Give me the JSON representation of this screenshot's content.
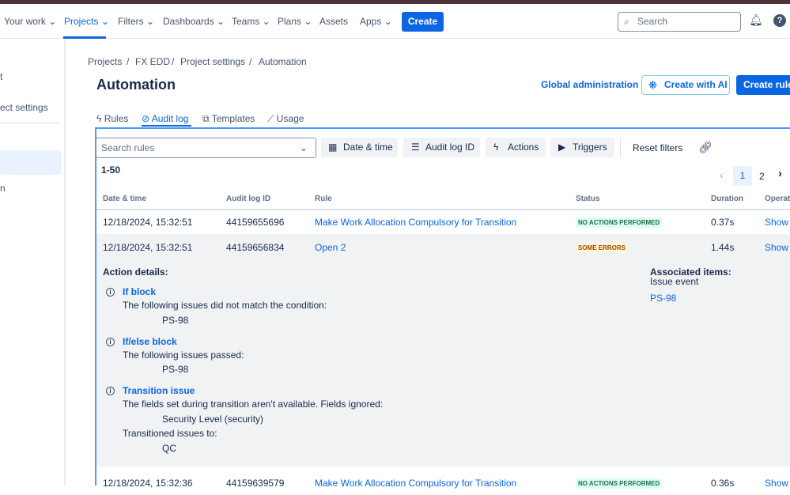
{
  "nav": {
    "items": [
      "Your work",
      "Projects",
      "Filters",
      "Dashboards",
      "Teams",
      "Plans",
      "Assets",
      "Apps"
    ],
    "create": "Create",
    "search_placeholder": "Search"
  },
  "sidebar": {
    "items": [
      "t",
      "ect settings",
      "n"
    ]
  },
  "breadcrumb": [
    "Projects",
    "FX EDD",
    "Project settings",
    "Automation"
  ],
  "page_title": "Automation",
  "header_actions": {
    "global_admin": "Global administration",
    "create_ai": "Create with AI",
    "create_rule": "Create rule"
  },
  "tabs": [
    "Rules",
    "Audit log",
    "Templates",
    "Usage"
  ],
  "filters": {
    "search_placeholder": "Search rules",
    "date": "Date & time",
    "audit_id": "Audit log ID",
    "actions": "Actions",
    "triggers": "Triggers",
    "reset": "Reset filters"
  },
  "range": "1-50",
  "pagination": {
    "pages": [
      "1",
      "2"
    ],
    "current": "1"
  },
  "columns": [
    "Date & time",
    "Audit log ID",
    "Rule",
    "Status",
    "Duration",
    "Operati"
  ],
  "rows": [
    {
      "date": "12/18/2024, 15:32:51",
      "id": "44159655696",
      "rule": "Make Work Allocation Compulsory for Transition",
      "status": "NO ACTIONS PERFORMED",
      "duration": "0.37s",
      "op": "Show"
    },
    {
      "date": "12/18/2024, 15:32:51",
      "id": "44159656834",
      "rule": "Open 2",
      "status": "SOME ERRORS",
      "duration": "1.44s",
      "op": "Show"
    },
    {
      "date": "12/18/2024, 15:32:36",
      "id": "44159639579",
      "rule": "Make Work Allocation Compulsory for Transition",
      "status": "NO ACTIONS PERFORMED",
      "duration": "0.36s",
      "op": "Show"
    }
  ],
  "details": {
    "title": "Action details:",
    "blocks": [
      {
        "name": "If block",
        "text": "The following issues did not match the condition:",
        "item": "PS-98"
      },
      {
        "name": "If/else block",
        "text": "The following issues passed:",
        "item": "PS-98"
      },
      {
        "name": "Transition issue",
        "text": "The fields set during transition aren't available. Fields ignored:",
        "item": "Security Level (security)",
        "text2": "Transitioned issues to:",
        "item2": "QC"
      }
    ],
    "assoc_title": "Associated items:",
    "assoc_type": "Issue event",
    "assoc_item": "PS-98"
  },
  "colors": {
    "brand": "#0c66e4",
    "success_bg": "#dcfff1",
    "success_fg": "#216e4e",
    "warn_bg": "#fff7d6",
    "warn_fg": "#a54800"
  }
}
